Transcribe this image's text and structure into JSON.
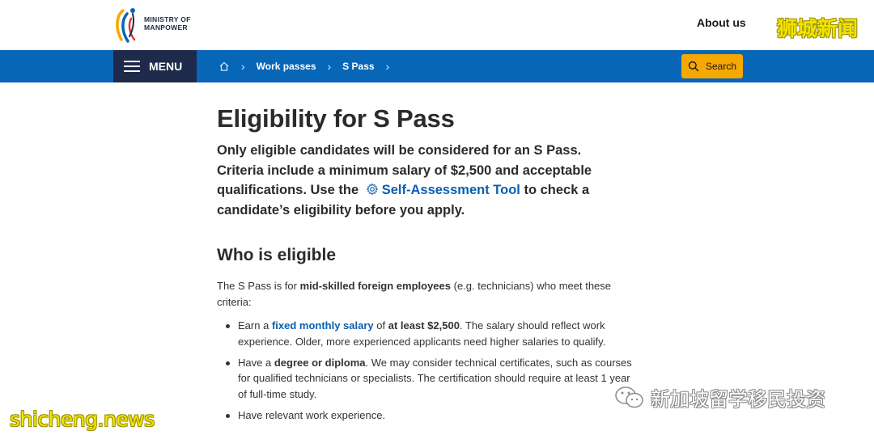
{
  "header": {
    "logo_text_line1": "MINISTRY OF",
    "logo_text_line2": "MANPOWER",
    "about_label": "About us",
    "watermark_top": "狮城新闻"
  },
  "navbar": {
    "menu_label": "MENU",
    "breadcrumbs": [
      "Work passes",
      "S Pass"
    ],
    "search_label": "Search",
    "bar_color": "#0866b6",
    "menu_color": "#1e2a4a",
    "search_color": "#f5a800"
  },
  "main": {
    "title": "Eligibility for S Pass",
    "lead_part1": "Only eligible candidates will be considered for an S Pass. Criteria include a minimum salary of $2,500 and acceptable qualifications. Use the",
    "lead_link": "Self-Assessment Tool",
    "lead_part2": "to check a candidate’s eligibility before you apply.",
    "section_heading": "Who is eligible",
    "intro_part1": "The S Pass is for",
    "intro_bold": "mid-skilled foreign employees",
    "intro_part2": "(e.g. technicians) who meet these criteria:",
    "criteria": [
      {
        "pre": "Earn a",
        "link": "fixed monthly salary",
        "mid": "of",
        "bold": "at least $2,500",
        "post": ". The salary should reflect work experience. Older, more experienced applicants need higher salaries to qualify."
      },
      {
        "pre": "Have a",
        "bold": "degree or diploma",
        "post": ". We may consider technical certificates, such as courses for qualified technicians or specialists. The certification should require at least 1 year of full-time study."
      },
      {
        "text": "Have relevant work experience."
      }
    ]
  },
  "watermarks": {
    "bottom_left": "shicheng.news",
    "bottom_right": "新加坡留学移民投资"
  }
}
